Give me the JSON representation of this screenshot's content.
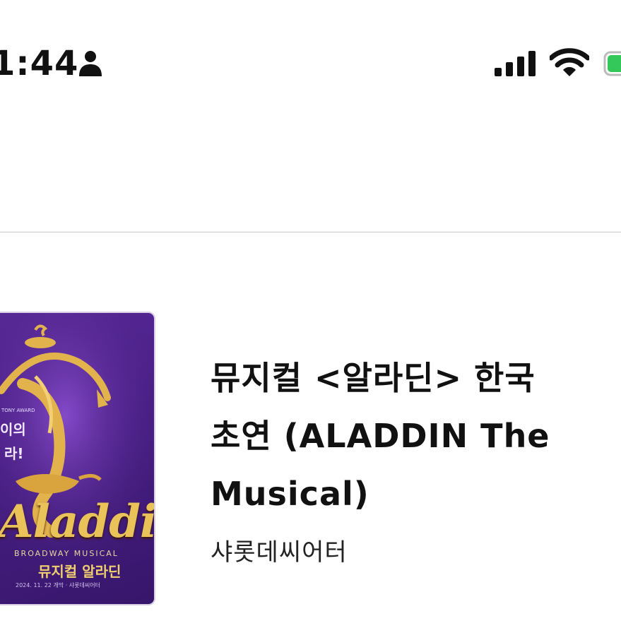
{
  "status_bar": {
    "time": "1:44",
    "icons": [
      "person-icon",
      "signal-icon",
      "wifi-icon",
      "battery-icon"
    ],
    "battery_color": "#34c759"
  },
  "poster": {
    "title_art": "Aladdin",
    "subtitle_art": "BROADWAY MUSICAL",
    "korean_title_art": "뮤지컬 알라딘",
    "date_art": "2024. 11. 22 개막 · 샤롯데씨어터",
    "background_color": "#4a1f85",
    "accent_color": "#e9c35a"
  },
  "show": {
    "title": "뮤지컬 <알라딘> 한국\n초연  (ALADDIN The\nMusical)",
    "venue": "샤롯데씨어터"
  }
}
